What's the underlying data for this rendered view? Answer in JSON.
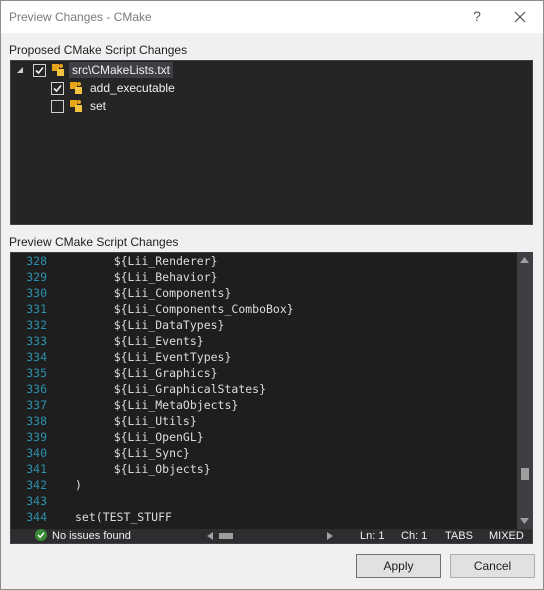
{
  "window": {
    "title": "Preview Changes - CMake",
    "help_glyph": "?"
  },
  "proposed_label": "Proposed CMake Script Changes",
  "tree": [
    {
      "label": "src\\CMakeLists.txt",
      "checked": true,
      "selected": true,
      "level": 0,
      "expanded": true
    },
    {
      "label": "add_executable",
      "checked": true,
      "selected": false,
      "level": 1
    },
    {
      "label": "set",
      "checked": false,
      "selected": false,
      "level": 1
    }
  ],
  "preview_label": "Preview CMake Script Changes",
  "code_lines": [
    {
      "ln": "328",
      "text": "    ${Lii_Renderer}"
    },
    {
      "ln": "329",
      "text": "    ${Lii_Behavior}"
    },
    {
      "ln": "330",
      "text": "    ${Lii_Components}"
    },
    {
      "ln": "331",
      "text": "    ${Lii_Components_ComboBox}"
    },
    {
      "ln": "332",
      "text": "    ${Lii_DataTypes}"
    },
    {
      "ln": "333",
      "text": "    ${Lii_Events}"
    },
    {
      "ln": "334",
      "text": "    ${Lii_EventTypes}"
    },
    {
      "ln": "335",
      "text": "    ${Lii_Graphics}"
    },
    {
      "ln": "336",
      "text": "    ${Lii_GraphicalStates}"
    },
    {
      "ln": "337",
      "text": "    ${Lii_MetaObjects}"
    },
    {
      "ln": "338",
      "text": "    ${Lii_Utils}"
    },
    {
      "ln": "339",
      "text": "    ${Lii_OpenGL}"
    },
    {
      "ln": "340",
      "text": "    ${Lii_Sync}"
    },
    {
      "ln": "341",
      "text": "    ${Lii_Objects}"
    },
    {
      "ln": "342",
      "text": ")"
    },
    {
      "ln": "343",
      "text": ""
    },
    {
      "ln": "344",
      "text": "set(TEST_STUFF"
    }
  ],
  "status": {
    "issues": "No issues found",
    "line": "Ln: 1",
    "col": "Ch: 1",
    "indent": "TABS",
    "eol": "MIXED"
  },
  "buttons": {
    "apply": "Apply",
    "cancel": "Cancel"
  },
  "colors": {
    "editor_bg": "#1e1e1e",
    "line_number": "#2b91af",
    "ok_green": "#388a34"
  }
}
